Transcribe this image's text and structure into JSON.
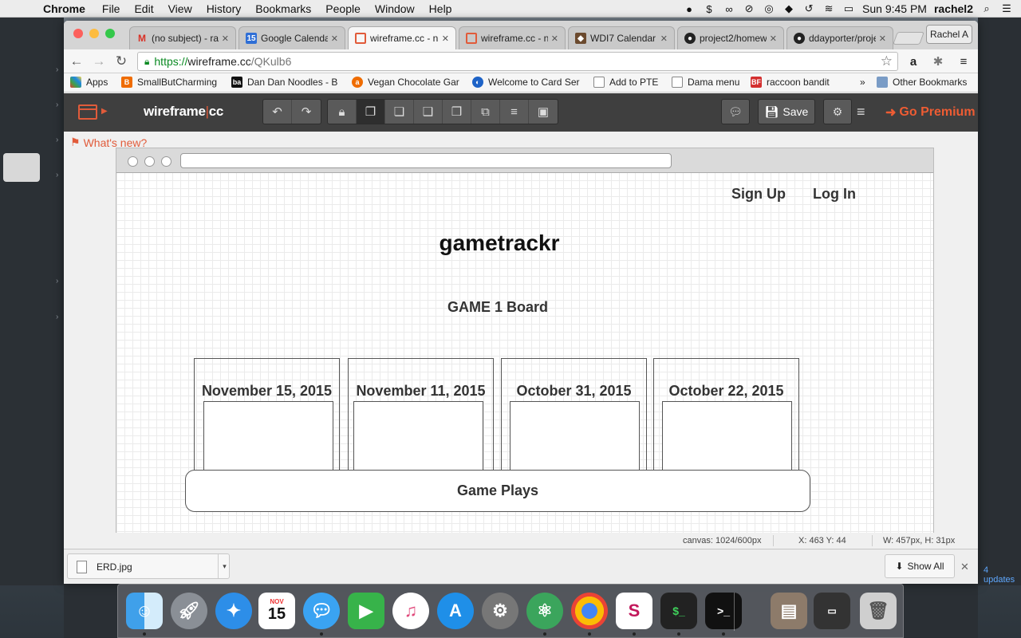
{
  "menubar": {
    "app_name": "Chrome",
    "items": [
      "File",
      "Edit",
      "View",
      "History",
      "Bookmarks",
      "People",
      "Window",
      "Help"
    ],
    "clock": "Sun 9:45 PM",
    "user": "rachel2"
  },
  "tabs": [
    {
      "label": "(no subject) - ra",
      "icon": "gmail-icon"
    },
    {
      "label": "Google Calendar",
      "icon": "calendar-icon"
    },
    {
      "label": "wireframe.cc - n",
      "icon": "wireframe-icon",
      "active": true
    },
    {
      "label": "wireframe.cc - n",
      "icon": "wireframe-icon"
    },
    {
      "label": "WDI7 Calendar",
      "icon": "wdi-icon"
    },
    {
      "label": "project2/homew",
      "icon": "github-icon"
    },
    {
      "label": "ddayporter/proje",
      "icon": "github-icon"
    }
  ],
  "profile": "Rachel A",
  "address": {
    "scheme": "https://",
    "host": "wireframe.cc",
    "path": "/QKulb6"
  },
  "bookmarks": {
    "items": [
      "Apps",
      "SmallButCharming",
      "Dan Dan Noodles - B",
      "Vegan Chocolate Gar",
      "Welcome to Card Ser",
      "Add to PTE",
      "Dama menu",
      "raccoon bandit"
    ],
    "overflow": "»",
    "other": "Other Bookmarks"
  },
  "wf": {
    "brand_left": "wireframe",
    "brand_sep": "|",
    "brand_right": "cc",
    "save": "Save",
    "premium": "Go Premium",
    "whats_new": "What's new?"
  },
  "wireframe": {
    "links": [
      "Sign Up",
      "Log In"
    ],
    "title": "gametrackr",
    "subtitle": "GAME 1 Board",
    "cards": [
      "November 15, 2015",
      "November 11, 2015",
      "October 31, 2015",
      "October 22, 2015"
    ],
    "plays": "Game Plays"
  },
  "status": {
    "canvas": "canvas: 1024/600px",
    "xy": "X: 463 Y: 44",
    "wh": "W: 457px, H: 31px"
  },
  "download": {
    "file": "ERD.jpg",
    "show_all": "Show All"
  },
  "dock_calendar": {
    "month": "NOV",
    "day": "15"
  },
  "bg": {
    "updates": "4 updates"
  },
  "colors": {
    "accent": "#e15b3a",
    "toolbar": "#3f3f3f",
    "link_green": "#0a8a22"
  }
}
